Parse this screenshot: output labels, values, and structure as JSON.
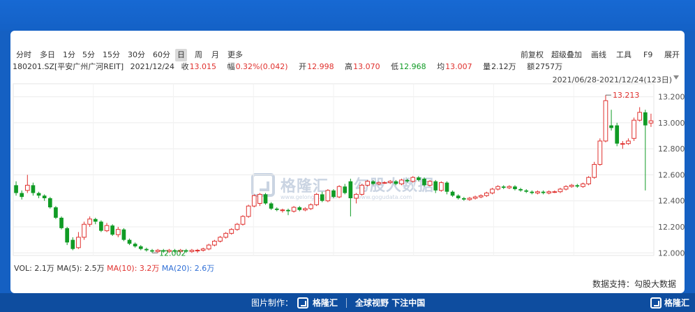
{
  "periods": [
    "分时",
    "多日",
    "1分",
    "5分",
    "15分",
    "30分",
    "60分",
    "日",
    "周",
    "月",
    "更多"
  ],
  "active_period": "日",
  "tools": [
    "前复权",
    "超级叠加",
    "画线",
    "工具",
    "F9",
    "展开"
  ],
  "stock": {
    "code_name": "180201.SZ[平安广州广河REIT]",
    "date": "2021/12/24",
    "close_label": "收",
    "close": "13.015",
    "change_label": "幅",
    "change": "0.32%(0.042)",
    "open_label": "开",
    "open": "12.998",
    "high_label": "高",
    "high": "13.070",
    "low_label": "低",
    "low": "12.968",
    "avg_label": "均",
    "avg": "13.007",
    "volume_label": "量",
    "volume": "2.12万",
    "amount_label": "额",
    "amount": "2757万"
  },
  "date_range": "2021/06/28-2021/12/24(123日)",
  "volume_bar": {
    "vol": "VOL: 2.1万",
    "ma5": "MA(5): 2.5万",
    "ma10": "MA(10): 3.2万",
    "ma20": "MA(20): 2.6万"
  },
  "data_support": "数据支持：勾股大数据",
  "watermark": {
    "brand1": "格隆汇",
    "site1": "www.gelonghui.com",
    "brand2": "勾股大数据",
    "site2": "www.gogudata.com"
  },
  "footer": {
    "made_by": "图片制作：",
    "brand": "格隆汇",
    "slogan": "全球视野 下注中国",
    "corner": "格隆汇"
  },
  "colors": {
    "up": "#e0312e",
    "down": "#109b25",
    "footer_bg": "#0e4d9f",
    "page_bg": "#1560c2"
  },
  "chart_data": {
    "type": "candlestick",
    "ylim": [
      11.98,
      13.3
    ],
    "yticks": [
      "13.200",
      "13.000",
      "12.800",
      "12.600",
      "12.400",
      "12.200",
      "12.000"
    ],
    "annotations": {
      "max": "13.213",
      "min": "12.002"
    },
    "candles": [
      {
        "o": 12.52,
        "c": 12.46,
        "h": 12.55,
        "l": 12.44
      },
      {
        "o": 12.46,
        "c": 12.43,
        "h": 12.48,
        "l": 12.41
      },
      {
        "o": 12.48,
        "c": 12.52,
        "h": 12.6,
        "l": 12.46
      },
      {
        "o": 12.52,
        "c": 12.46,
        "h": 12.54,
        "l": 12.44
      },
      {
        "o": 12.46,
        "c": 12.44,
        "h": 12.47,
        "l": 12.42
      },
      {
        "o": 12.44,
        "c": 12.42,
        "h": 12.45,
        "l": 12.4
      },
      {
        "o": 12.42,
        "c": 12.35,
        "h": 12.43,
        "l": 12.34
      },
      {
        "o": 12.35,
        "c": 12.27,
        "h": 12.36,
        "l": 12.26
      },
      {
        "o": 12.27,
        "c": 12.19,
        "h": 12.28,
        "l": 12.18
      },
      {
        "o": 12.19,
        "c": 12.08,
        "h": 12.2,
        "l": 12.06
      },
      {
        "o": 12.1,
        "c": 12.03,
        "h": 12.12,
        "l": 12.02
      },
      {
        "o": 12.04,
        "c": 12.12,
        "h": 12.16,
        "l": 12.03
      },
      {
        "o": 12.12,
        "c": 12.22,
        "h": 12.24,
        "l": 12.1
      },
      {
        "o": 12.22,
        "c": 12.26,
        "h": 12.28,
        "l": 12.2
      },
      {
        "o": 12.26,
        "c": 12.24,
        "h": 12.27,
        "l": 12.22
      },
      {
        "o": 12.24,
        "c": 12.17,
        "h": 12.25,
        "l": 12.16
      },
      {
        "o": 12.17,
        "c": 12.21,
        "h": 12.23,
        "l": 12.16
      },
      {
        "o": 12.21,
        "c": 12.14,
        "h": 12.22,
        "l": 12.13
      },
      {
        "o": 12.14,
        "c": 12.18,
        "h": 12.2,
        "l": 12.12
      },
      {
        "o": 12.18,
        "c": 12.1,
        "h": 12.19,
        "l": 12.09
      },
      {
        "o": 12.1,
        "c": 12.07,
        "h": 12.11,
        "l": 12.06
      },
      {
        "o": 12.07,
        "c": 12.05,
        "h": 12.08,
        "l": 12.04
      },
      {
        "o": 12.05,
        "c": 12.03,
        "h": 12.06,
        "l": 12.02
      },
      {
        "o": 12.03,
        "c": 12.02,
        "h": 12.04,
        "l": 12.01
      },
      {
        "o": 12.02,
        "c": 12.01,
        "h": 12.03,
        "l": 12.0
      },
      {
        "o": 12.01,
        "c": 12.02,
        "h": 12.03,
        "l": 12.0
      },
      {
        "o": 12.02,
        "c": 12.01,
        "h": 12.03,
        "l": 12.0
      },
      {
        "o": 12.01,
        "c": 12.02,
        "h": 12.03,
        "l": 12.0
      },
      {
        "o": 12.02,
        "c": 12.01,
        "h": 12.03,
        "l": 12.0
      },
      {
        "o": 12.01,
        "c": 12.02,
        "h": 12.03,
        "l": 12.0
      },
      {
        "o": 12.02,
        "c": 12.01,
        "h": 12.03,
        "l": 12.0
      },
      {
        "o": 12.01,
        "c": 12.02,
        "h": 12.03,
        "l": 12.0
      },
      {
        "o": 12.02,
        "c": 12.02,
        "h": 12.03,
        "l": 12.0
      },
      {
        "o": 12.02,
        "c": 12.03,
        "h": 12.04,
        "l": 12.01
      },
      {
        "o": 12.03,
        "c": 12.06,
        "h": 12.07,
        "l": 12.02
      },
      {
        "o": 12.06,
        "c": 12.09,
        "h": 12.1,
        "l": 12.05
      },
      {
        "o": 12.09,
        "c": 12.12,
        "h": 12.13,
        "l": 12.08
      },
      {
        "o": 12.12,
        "c": 12.15,
        "h": 12.16,
        "l": 12.11
      },
      {
        "o": 12.15,
        "c": 12.18,
        "h": 12.19,
        "l": 12.14
      },
      {
        "o": 12.18,
        "c": 12.22,
        "h": 12.23,
        "l": 12.17
      },
      {
        "o": 12.22,
        "c": 12.28,
        "h": 12.29,
        "l": 12.21
      },
      {
        "o": 12.28,
        "c": 12.36,
        "h": 12.37,
        "l": 12.27
      },
      {
        "o": 12.36,
        "c": 12.44,
        "h": 12.45,
        "l": 12.35
      },
      {
        "o": 12.38,
        "c": 12.45,
        "h": 12.46,
        "l": 12.36
      },
      {
        "o": 12.45,
        "c": 12.38,
        "h": 12.46,
        "l": 12.37
      },
      {
        "o": 12.38,
        "c": 12.34,
        "h": 12.39,
        "l": 12.33
      },
      {
        "o": 12.34,
        "c": 12.33,
        "h": 12.35,
        "l": 12.32
      },
      {
        "o": 12.33,
        "c": 12.33,
        "h": 12.34,
        "l": 12.31
      },
      {
        "o": 12.33,
        "c": 12.32,
        "h": 12.34,
        "l": 12.29
      },
      {
        "o": 12.32,
        "c": 12.35,
        "h": 12.36,
        "l": 12.31
      },
      {
        "o": 12.35,
        "c": 12.33,
        "h": 12.36,
        "l": 12.32
      },
      {
        "o": 12.33,
        "c": 12.34,
        "h": 12.35,
        "l": 12.32
      },
      {
        "o": 12.34,
        "c": 12.37,
        "h": 12.38,
        "l": 12.33
      },
      {
        "o": 12.37,
        "c": 12.45,
        "h": 12.46,
        "l": 12.36
      },
      {
        "o": 12.45,
        "c": 12.4,
        "h": 12.47,
        "l": 12.39
      },
      {
        "o": 12.4,
        "c": 12.48,
        "h": 12.49,
        "l": 12.39
      },
      {
        "o": 12.48,
        "c": 12.43,
        "h": 12.49,
        "l": 12.42
      },
      {
        "o": 12.43,
        "c": 12.51,
        "h": 12.52,
        "l": 12.42
      },
      {
        "o": 12.51,
        "c": 12.46,
        "h": 12.53,
        "l": 12.45
      },
      {
        "o": 12.55,
        "c": 12.42,
        "h": 12.57,
        "l": 12.28
      },
      {
        "o": 12.42,
        "c": 12.45,
        "h": 12.46,
        "l": 12.38
      },
      {
        "o": 12.45,
        "c": 12.52,
        "h": 12.53,
        "l": 12.44
      },
      {
        "o": 12.52,
        "c": 12.55,
        "h": 12.56,
        "l": 12.51
      },
      {
        "o": 12.55,
        "c": 12.53,
        "h": 12.56,
        "l": 12.52
      },
      {
        "o": 12.53,
        "c": 12.54,
        "h": 12.55,
        "l": 12.52
      },
      {
        "o": 12.54,
        "c": 12.54,
        "h": 12.55,
        "l": 12.53
      },
      {
        "o": 12.54,
        "c": 12.55,
        "h": 12.56,
        "l": 12.53
      },
      {
        "o": 12.55,
        "c": 12.53,
        "h": 12.56,
        "l": 12.52
      },
      {
        "o": 12.53,
        "c": 12.56,
        "h": 12.57,
        "l": 12.52
      },
      {
        "o": 12.56,
        "c": 12.55,
        "h": 12.57,
        "l": 12.54
      },
      {
        "o": 12.55,
        "c": 12.58,
        "h": 12.59,
        "l": 12.54
      },
      {
        "o": 12.58,
        "c": 12.56,
        "h": 12.59,
        "l": 12.55
      },
      {
        "o": 12.57,
        "c": 12.52,
        "h": 12.58,
        "l": 12.51
      },
      {
        "o": 12.52,
        "c": 12.55,
        "h": 12.56,
        "l": 12.51
      },
      {
        "o": 12.55,
        "c": 12.48,
        "h": 12.56,
        "l": 12.46
      },
      {
        "o": 12.48,
        "c": 12.54,
        "h": 12.55,
        "l": 12.47
      },
      {
        "o": 12.54,
        "c": 12.47,
        "h": 12.55,
        "l": 12.45
      },
      {
        "o": 12.47,
        "c": 12.44,
        "h": 12.48,
        "l": 12.43
      },
      {
        "o": 12.44,
        "c": 12.42,
        "h": 12.45,
        "l": 12.41
      },
      {
        "o": 12.42,
        "c": 12.41,
        "h": 12.43,
        "l": 12.4
      },
      {
        "o": 12.41,
        "c": 12.42,
        "h": 12.43,
        "l": 12.4
      },
      {
        "o": 12.42,
        "c": 12.43,
        "h": 12.44,
        "l": 12.41
      },
      {
        "o": 12.43,
        "c": 12.44,
        "h": 12.45,
        "l": 12.42
      },
      {
        "o": 12.44,
        "c": 12.46,
        "h": 12.47,
        "l": 12.43
      },
      {
        "o": 12.46,
        "c": 12.49,
        "h": 12.5,
        "l": 12.45
      },
      {
        "o": 12.49,
        "c": 12.51,
        "h": 12.52,
        "l": 12.48
      },
      {
        "o": 12.51,
        "c": 12.5,
        "h": 12.52,
        "l": 12.49
      },
      {
        "o": 12.5,
        "c": 12.51,
        "h": 12.52,
        "l": 12.49
      },
      {
        "o": 12.51,
        "c": 12.49,
        "h": 12.52,
        "l": 12.48
      },
      {
        "o": 12.49,
        "c": 12.48,
        "h": 12.5,
        "l": 12.47
      },
      {
        "o": 12.48,
        "c": 12.47,
        "h": 12.49,
        "l": 12.46
      },
      {
        "o": 12.47,
        "c": 12.46,
        "h": 12.48,
        "l": 12.45
      },
      {
        "o": 12.46,
        "c": 12.47,
        "h": 12.48,
        "l": 12.45
      },
      {
        "o": 12.47,
        "c": 12.46,
        "h": 12.48,
        "l": 12.45
      },
      {
        "o": 12.46,
        "c": 12.47,
        "h": 12.48,
        "l": 12.45
      },
      {
        "o": 12.47,
        "c": 12.47,
        "h": 12.48,
        "l": 12.46
      },
      {
        "o": 12.47,
        "c": 12.49,
        "h": 12.5,
        "l": 12.46
      },
      {
        "o": 12.49,
        "c": 12.51,
        "h": 12.52,
        "l": 12.48
      },
      {
        "o": 12.51,
        "c": 12.52,
        "h": 12.53,
        "l": 12.5
      },
      {
        "o": 12.52,
        "c": 12.51,
        "h": 12.53,
        "l": 12.5
      },
      {
        "o": 12.51,
        "c": 12.53,
        "h": 12.54,
        "l": 12.5
      },
      {
        "o": 12.53,
        "c": 12.58,
        "h": 12.59,
        "l": 12.52
      },
      {
        "o": 12.58,
        "c": 12.68,
        "h": 12.7,
        "l": 12.57
      },
      {
        "o": 12.68,
        "c": 12.86,
        "h": 12.88,
        "l": 12.67
      },
      {
        "o": 12.86,
        "c": 13.17,
        "h": 13.213,
        "l": 12.85
      },
      {
        "o": 12.98,
        "c": 12.96,
        "h": 13.1,
        "l": 12.94
      },
      {
        "o": 12.98,
        "c": 12.84,
        "h": 13.0,
        "l": 12.82
      },
      {
        "o": 12.84,
        "c": 12.84,
        "h": 12.86,
        "l": 12.8
      },
      {
        "o": 12.84,
        "c": 12.86,
        "h": 12.88,
        "l": 12.83
      },
      {
        "o": 12.88,
        "c": 13.02,
        "h": 13.04,
        "l": 12.86
      },
      {
        "o": 13.02,
        "c": 13.08,
        "h": 13.12,
        "l": 13.01
      },
      {
        "o": 13.08,
        "c": 12.98,
        "h": 13.1,
        "l": 12.48
      },
      {
        "o": 12.998,
        "c": 13.015,
        "h": 13.07,
        "l": 12.968
      }
    ]
  }
}
